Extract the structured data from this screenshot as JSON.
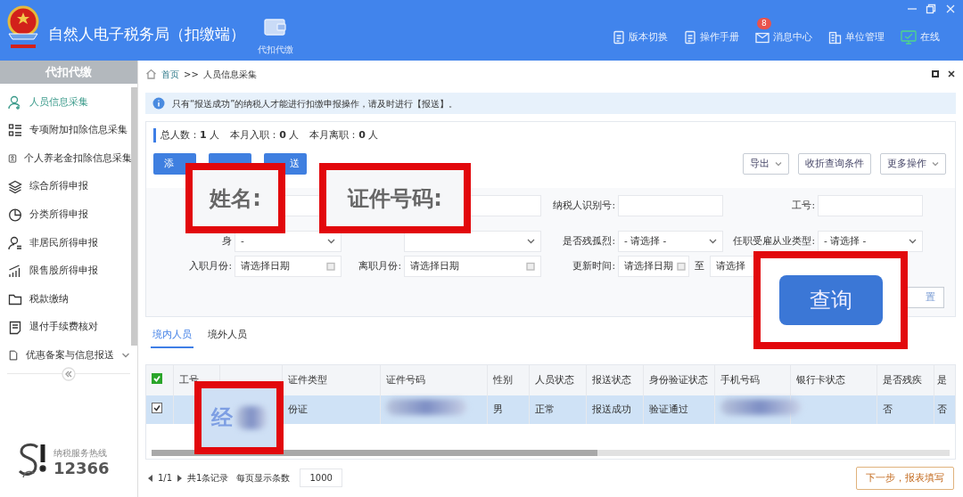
{
  "window": {
    "title": "自然人电子税务局（扣缴端）"
  },
  "top_nav": [
    {
      "label": "代扣代缴"
    }
  ],
  "top_tools": [
    {
      "label": "版本切换"
    },
    {
      "label": "操作手册"
    },
    {
      "label": "消息中心",
      "badge": "8"
    },
    {
      "label": "单位管理"
    },
    {
      "label": "在线"
    }
  ],
  "sidebar": {
    "title": "代扣代缴",
    "items": [
      {
        "label": "人员信息采集",
        "selected": true,
        "kind": "link"
      },
      {
        "label": "专项附加扣除信息采集",
        "selected": false,
        "kind": "link"
      },
      {
        "label": "个人养老金扣除信息采集",
        "selected": false,
        "kind": "link"
      },
      {
        "label": "综合所得申报",
        "selected": false,
        "kind": "link"
      },
      {
        "label": "分类所得申报",
        "selected": false,
        "kind": "link"
      },
      {
        "label": "非居民所得申报",
        "selected": false,
        "kind": "link"
      },
      {
        "label": "限售股所得申报",
        "selected": false,
        "kind": "link"
      },
      {
        "label": "税款缴纳",
        "selected": false,
        "kind": "link"
      },
      {
        "label": "退付手续费核对",
        "selected": false,
        "kind": "link"
      },
      {
        "label": "优惠备案与信息报送",
        "selected": false,
        "kind": "group"
      }
    ]
  },
  "hotline": {
    "label": "纳税服务热线",
    "number": "12366"
  },
  "breadcrumb": {
    "items": [
      "首页",
      "人员信息采集"
    ],
    "separator": ">>"
  },
  "notice": "只有“报送成功”的纳税人才能进行扣缴申报操作，请及时进行【报送】。",
  "stats": [
    "总人数：**1** 人",
    "本月入职：**0** 人",
    "本月离职：**0** 人"
  ],
  "actions": [
    {
      "kind": "primary",
      "label": "添"
    },
    {
      "kind": "primary"
    },
    {
      "kind": "primary",
      "label": "送"
    }
  ],
  "tools": [
    {
      "label": "导出",
      "dropdown": true
    },
    {
      "label": "收折查询条件",
      "dropdown": false
    },
    {
      "label": "更多操作",
      "dropdown": true
    }
  ],
  "filters": [
    [
      {
        "kind": "text"
      },
      {
        "kind": "text"
      },
      {
        "label": "纳税人识别号:",
        "kind": "text"
      },
      {
        "label": "工号:",
        "kind": "text"
      }
    ],
    [
      {
        "label": "身",
        "kind": "select",
        "value": "-"
      },
      {
        "kind": "select"
      },
      {
        "label": "是否残孤烈:",
        "kind": "select",
        "value": "- 请选择 -"
      },
      {
        "label": "任职受雇从业类型:",
        "kind": "select",
        "value": "- 请选择 -"
      }
    ],
    [
      {
        "label": "入职月份:",
        "kind": "date",
        "placeholder": "请选择日期"
      },
      {
        "label": "离职月份:",
        "kind": "date",
        "placeholder": "请选择日期"
      },
      {
        "label": "更新时间:",
        "kind": "range",
        "placeholder": "请选择日期",
        "separator": "至",
        "placeholder_to": "请选择"
      }
    ]
  ],
  "reset": {
    "label": "置"
  },
  "tabs": [
    {
      "label": "境内人员",
      "selected": true
    },
    {
      "label": "境外人员",
      "selected": false
    }
  ],
  "table": {
    "header_checked": true,
    "columns": [
      {
        "label": "工号"
      },
      {},
      {
        "label": "证件类型"
      },
      {
        "label": "证件号码"
      },
      {
        "label": "性别"
      },
      {
        "label": "人员状态"
      },
      {
        "label": "报送状态"
      },
      {
        "label": "身份验证状态"
      },
      {
        "label": "手机号码"
      },
      {
        "label": "银行卡状态"
      },
      {
        "label": "是否残疾"
      },
      {
        "label": "是"
      }
    ],
    "rows": [
      {
        "checked": true,
        "selected": true,
        "cells": [
          null,
          null,
          "份证",
          {
            "kind": "blurred"
          },
          "男",
          "正常",
          "报送成功",
          "验证通过",
          {
            "kind": "blurred"
          },
          null,
          "否",
          "否"
        ]
      }
    ]
  },
  "pager": {
    "page": "1/1",
    "total": "共1条记录",
    "size_label": "每页显示条数",
    "size": "1000"
  },
  "next_button": "下一步，报表填写",
  "callouts": [
    {
      "kind": "label",
      "text": "姓名:"
    },
    {
      "kind": "label",
      "text": "证件号码:"
    },
    {
      "kind": "button",
      "text": "查询"
    },
    {
      "kind": "cell",
      "text": "经"
    }
  ]
}
